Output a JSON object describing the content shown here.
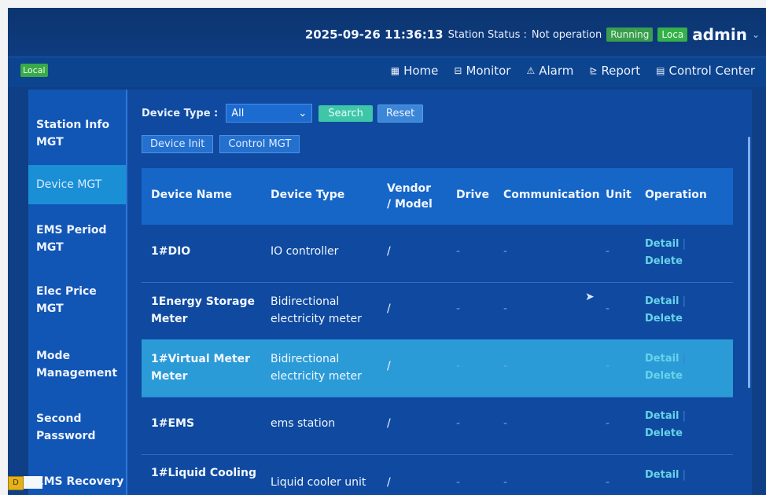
{
  "topbar": {
    "datetime": "2025-09-26 11:36:13",
    "station_status_label": "Station Status :",
    "station_status_value": "Not operation",
    "running_badge": "Running",
    "loca_badge": "Loca",
    "user": "admin"
  },
  "navbar": {
    "local_badge": "Local",
    "items": [
      {
        "label": "Home",
        "icon": "home-icon"
      },
      {
        "label": "Monitor",
        "icon": "monitor-icon"
      },
      {
        "label": "Alarm",
        "icon": "alarm-icon"
      },
      {
        "label": "Report",
        "icon": "report-icon"
      },
      {
        "label": "Control Center",
        "icon": "control-center-icon"
      }
    ]
  },
  "sidebar": {
    "items": [
      {
        "label": "Station Info MGT",
        "active": false
      },
      {
        "label": "Device MGT",
        "active": true
      },
      {
        "label": "EMS Period MGT",
        "active": false
      },
      {
        "label": "Elec Price MGT",
        "active": false
      },
      {
        "label": "Mode Management",
        "active": false
      },
      {
        "label": "Second Password",
        "active": false
      },
      {
        "label": "EMS Recovery",
        "active": false
      }
    ]
  },
  "filter": {
    "device_type_label": "Device Type :",
    "device_type_value": "All",
    "search_label": "Search",
    "reset_label": "Reset"
  },
  "tabs": {
    "device_init": "Device Init",
    "control_mgt": "Control MGT"
  },
  "table": {
    "columns": [
      "Device Name",
      "Device Type",
      "Vendor / Model",
      "Drive",
      "Communication",
      "Unit",
      "Operation"
    ],
    "rows": [
      {
        "name": "1#DIO",
        "type": "IO controller",
        "vendor": "/",
        "drive": "-",
        "comm": "-",
        "unit": "-",
        "highlight": false
      },
      {
        "name": "1Energy Storage Meter",
        "type": "Bidirectional electricity meter",
        "vendor": "/",
        "drive": "-",
        "comm": "-",
        "unit": "-",
        "highlight": false
      },
      {
        "name": "1#Virtual Meter Meter",
        "type": "Bidirectional electricity meter",
        "vendor": "/",
        "drive": "-",
        "comm": "-",
        "unit": "-",
        "highlight": true
      },
      {
        "name": "1#EMS",
        "type": "ems station",
        "vendor": "/",
        "drive": "-",
        "comm": "-",
        "unit": "-",
        "highlight": false
      },
      {
        "name": "1#Liquid Cooling",
        "type": "Liquid cooler unit",
        "vendor": "/",
        "drive": "-",
        "comm": "-",
        "unit": "-",
        "highlight": false
      }
    ],
    "detail_label": "Detail",
    "delete_label": "Delete"
  }
}
